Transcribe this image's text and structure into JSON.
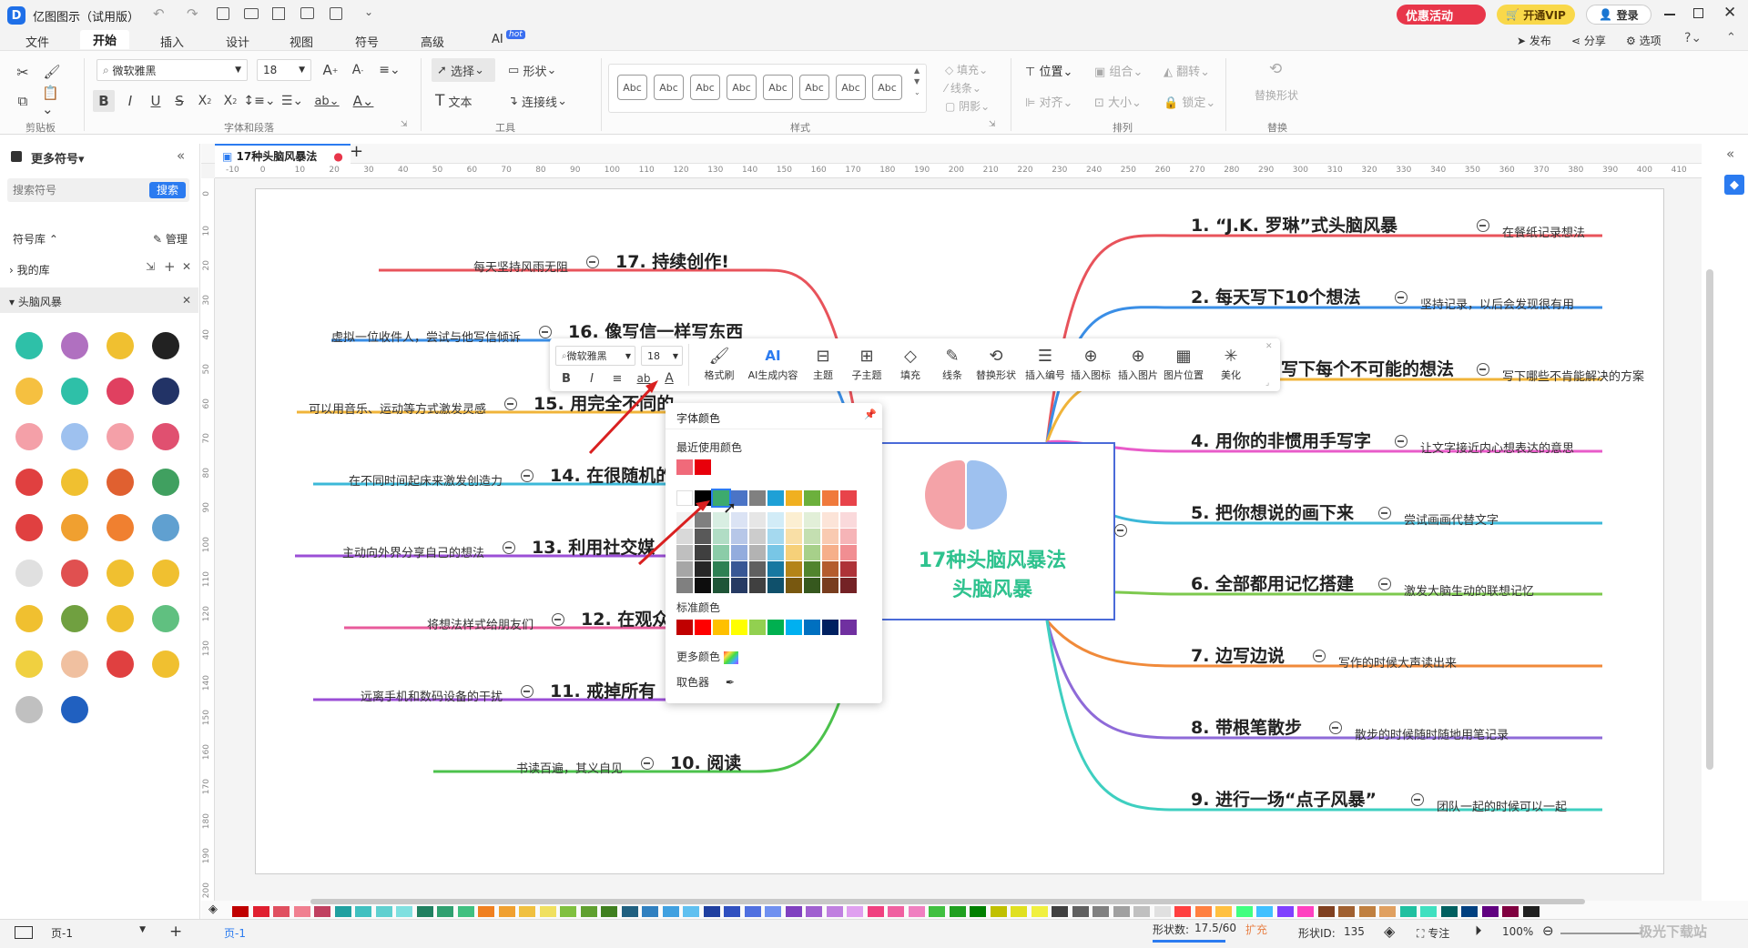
{
  "app": {
    "title": "亿图图示（试用版）",
    "promo": "优惠活动",
    "vip": "开通VIP",
    "login": "登录"
  },
  "menu": [
    "文件",
    "开始",
    "插入",
    "设计",
    "视图",
    "符号",
    "高级",
    "AI"
  ],
  "menu_ai_badge": "hot",
  "menu_right": [
    "发布",
    "分享",
    "选项"
  ],
  "ribbon": {
    "font_name": "微软雅黑",
    "font_size": "18",
    "select": "选择",
    "shape": "形状",
    "text": "文本",
    "connector": "连接线",
    "fill": "填充",
    "line": "线条",
    "shadow": "阴影",
    "position": "位置",
    "group": "组合",
    "flip": "翻转",
    "align": "对齐",
    "size": "大小",
    "lock": "锁定",
    "replace_shape": "替换形状",
    "style_abc": [
      "Abc",
      "Abc",
      "Abc",
      "Abc",
      "Abc",
      "Abc",
      "Abc",
      "Abc"
    ],
    "groups": [
      "剪贴板",
      "字体和段落",
      "工具",
      "样式",
      "排列",
      "替换"
    ]
  },
  "left": {
    "title": "更多符号",
    "search_placeholder": "搜索符号",
    "search_btn": "搜索",
    "library": "符号库",
    "manage": "管理",
    "my_library": "我的库",
    "category": "头脑风暴"
  },
  "doc_tab": {
    "name": "17种头脑风暴法"
  },
  "ruler_h": [
    "-10",
    "0",
    "10",
    "20",
    "30",
    "40",
    "50",
    "60",
    "70",
    "80",
    "90",
    "100",
    "110",
    "120",
    "130",
    "140",
    "150",
    "160",
    "170",
    "180",
    "190",
    "200",
    "210",
    "220",
    "230",
    "240",
    "250",
    "260",
    "270",
    "280",
    "290",
    "300",
    "310",
    "320",
    "330",
    "340",
    "350",
    "360",
    "370",
    "380",
    "390",
    "400",
    "410"
  ],
  "ruler_v": [
    "0",
    "10",
    "20",
    "30",
    "40",
    "50",
    "60",
    "70",
    "80",
    "90",
    "100",
    "110",
    "120",
    "130",
    "140",
    "150",
    "160",
    "170",
    "180",
    "190",
    "200"
  ],
  "mindmap": {
    "center": [
      "17种头脑风暴法",
      "头脑风暴"
    ],
    "right": [
      {
        "title": "1. “J.K. 罗琳”式头脑风暴",
        "note": "在餐纸记录想法",
        "color": "#e8535b"
      },
      {
        "title": "2. 每天写下10个想法",
        "note": "坚持记录，以后会发现很有用",
        "color": "#3a8ee6"
      },
      {
        "title": "3. 写下每个不可能的想法",
        "note": "写下哪些不肯能解决的方案",
        "color": "#f0b43a"
      },
      {
        "title": "4. 用你的非惯用手写字",
        "note": "让文字接近内心想表达的意思",
        "color": "#e85bc9"
      },
      {
        "title": "5. 把你想说的画下来",
        "note": "尝试画画代替文字",
        "color": "#3cb8d8"
      },
      {
        "title": "6. 全部都用记忆搭建",
        "note": "激发大脑生动的联想记忆",
        "color": "#7dc94e"
      },
      {
        "title": "7. 边写边说",
        "note": "写作的时候大声读出来",
        "color": "#f08a3a"
      },
      {
        "title": "8. 带根笔散步",
        "note": "散步的时候随时随地用笔记录",
        "color": "#8e6ad8"
      },
      {
        "title": "9. 进行一场“点子风暴”",
        "note": "团队一起的时候可以一起",
        "color": "#3ecfc0"
      }
    ],
    "left": [
      {
        "title": "17. 持续创作!",
        "note": "每天坚持风雨无阻",
        "color": "#e8535b"
      },
      {
        "title": "16. 像写信一样写东西",
        "note": "虚拟一位收件人，尝试与他写信倾诉",
        "color": "#3a8ee6"
      },
      {
        "title": "15. 用完全不同的",
        "note": "可以用音乐、运动等方式激发灵感",
        "color": "#f0b43a"
      },
      {
        "title": "14. 在很随机的",
        "note": "在不同时间起床来激发创造力",
        "color": "#3cb8d8"
      },
      {
        "title": "13. 利用社交媒",
        "note": "主动向外界分享自己的想法",
        "color": "#9b4fd6"
      },
      {
        "title": "12. 在观众面",
        "note": "将想法样式给朋友们",
        "color": "#e85b9b"
      },
      {
        "title": "11. 戒掉所有",
        "note": "远离手机和数码设备的干扰",
        "color": "#9b4fd6"
      },
      {
        "title": "10. 阅读",
        "note": "书读百遍，其义自见",
        "color": "#4cc24c"
      }
    ]
  },
  "floatbar": {
    "font": "微软雅黑",
    "size": "18",
    "items": [
      "格式刷",
      "AI生成内容",
      "主题",
      "子主题",
      "填充",
      "线条",
      "替换形状",
      "插入编号",
      "插入图标",
      "插入图片",
      "图片位置",
      "美化"
    ]
  },
  "colorpanel": {
    "title": "字体颜色",
    "recent": "最近使用颜色",
    "standard": "标准颜色",
    "more": "更多颜色",
    "picker": "取色器",
    "recent_colors": [
      "#f06a7a",
      "#e8000b"
    ],
    "theme_top": [
      "#ffffff",
      "#000000",
      "#3daa6e",
      "#4b74c6",
      "#808080",
      "#1ea0d6",
      "#f0b020",
      "#6cb03c",
      "#f07a3c",
      "#e8434a"
    ],
    "standard_colors": [
      "#c00000",
      "#ff0000",
      "#ffc000",
      "#ffff00",
      "#92d050",
      "#00b050",
      "#00b0f0",
      "#0070c0",
      "#002060",
      "#7030a0"
    ]
  },
  "status": {
    "page": "页-1",
    "page_tab": "页-1",
    "shape_count_label": "形状数:",
    "shape_count": "17.5/60",
    "expand": "扩充",
    "shape_id_label": "形状ID:",
    "shape_id": "135",
    "focus": "专注",
    "zoom": "100%"
  },
  "watermark": "极光下载站"
}
